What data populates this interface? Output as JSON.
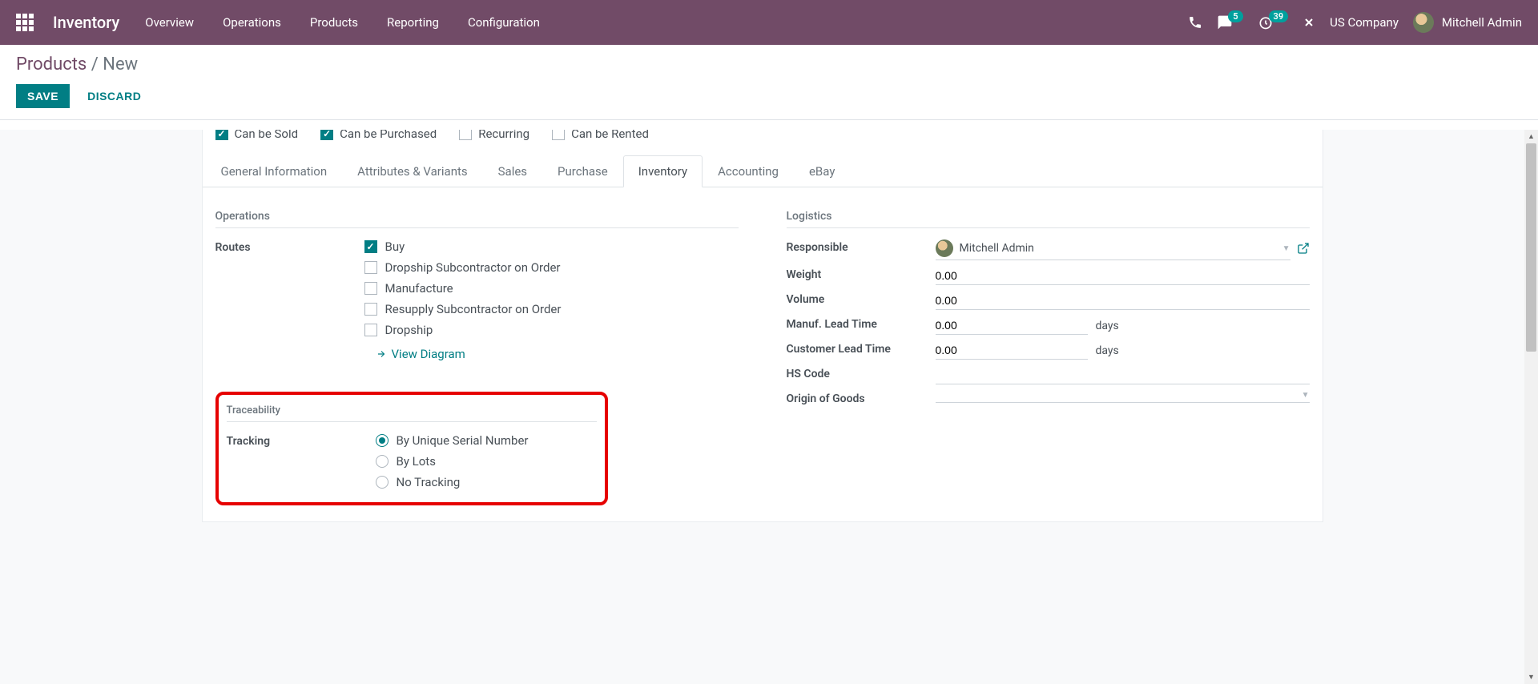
{
  "topbar": {
    "app_name": "Inventory",
    "nav": [
      "Overview",
      "Operations",
      "Products",
      "Reporting",
      "Configuration"
    ],
    "chat_badge": "5",
    "timer_badge": "39",
    "company": "US Company",
    "user": "Mitchell Admin"
  },
  "breadcrumb": {
    "parent": "Products",
    "sep": "/",
    "current": "New"
  },
  "actions": {
    "save": "SAVE",
    "discard": "DISCARD"
  },
  "flags": {
    "sold": {
      "label": "Can be Sold",
      "checked": true
    },
    "purchased": {
      "label": "Can be Purchased",
      "checked": true
    },
    "recurring": {
      "label": "Recurring",
      "checked": false
    },
    "rented": {
      "label": "Can be Rented",
      "checked": false
    }
  },
  "tabs": [
    "General Information",
    "Attributes & Variants",
    "Sales",
    "Purchase",
    "Inventory",
    "Accounting",
    "eBay"
  ],
  "active_tab": "Inventory",
  "operations": {
    "section": "Operations",
    "routes_label": "Routes",
    "routes": [
      {
        "label": "Buy",
        "checked": true
      },
      {
        "label": "Dropship Subcontractor on Order",
        "checked": false
      },
      {
        "label": "Manufacture",
        "checked": false
      },
      {
        "label": "Resupply Subcontractor on Order",
        "checked": false
      },
      {
        "label": "Dropship",
        "checked": false
      }
    ],
    "view_diagram": "View Diagram"
  },
  "logistics": {
    "section": "Logistics",
    "responsible_label": "Responsible",
    "responsible_value": "Mitchell Admin",
    "weight_label": "Weight",
    "weight_value": "0.00",
    "volume_label": "Volume",
    "volume_value": "0.00",
    "manuf_lead_label": "Manuf. Lead Time",
    "manuf_lead_value": "0.00",
    "cust_lead_label": "Customer Lead Time",
    "cust_lead_value": "0.00",
    "days": "days",
    "hs_label": "HS Code",
    "origin_label": "Origin of Goods"
  },
  "traceability": {
    "section": "Traceability",
    "tracking_label": "Tracking",
    "options": [
      {
        "label": "By Unique Serial Number",
        "checked": true
      },
      {
        "label": "By Lots",
        "checked": false
      },
      {
        "label": "No Tracking",
        "checked": false
      }
    ]
  }
}
